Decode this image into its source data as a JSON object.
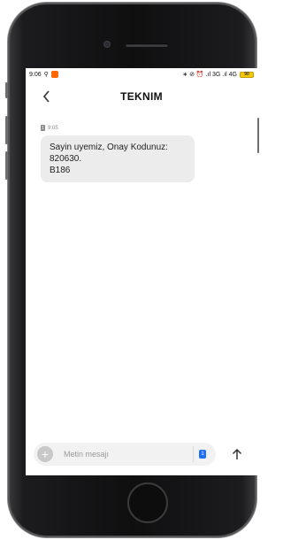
{
  "status_bar": {
    "time": "9:06",
    "right_icons": "∗ ⊘ ⏰ .ıl 3G .ıl 4G",
    "battery": "90"
  },
  "header": {
    "back_icon": "chevron-left",
    "title": "TEKNIM"
  },
  "messages": [
    {
      "time": "9:05",
      "sim": "1",
      "text_line1": "Sayin uyemiz, Onay Kodunuz: 820630.",
      "text_line2": "B186"
    }
  ],
  "composer": {
    "placeholder": "Metin mesajı",
    "sim_label": "1",
    "accent_color": "#1e6ff2"
  }
}
